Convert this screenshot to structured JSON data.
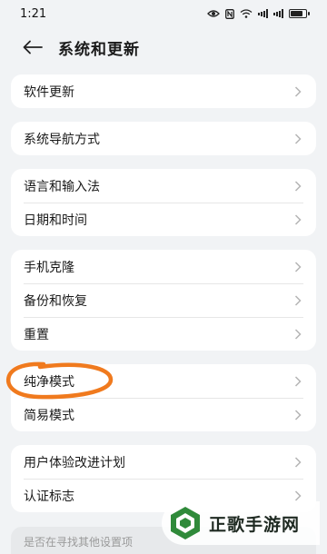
{
  "status": {
    "time": "1:21",
    "battery_level": 0.85
  },
  "header": {
    "title": "系统和更新",
    "back_icon": "arrow-left-icon"
  },
  "groups": [
    {
      "items": [
        {
          "label": "软件更新"
        }
      ]
    },
    {
      "items": [
        {
          "label": "系统导航方式"
        }
      ]
    },
    {
      "items": [
        {
          "label": "语言和输入法"
        },
        {
          "label": "日期和时间"
        }
      ]
    },
    {
      "items": [
        {
          "label": "手机克隆"
        },
        {
          "label": "备份和恢复"
        },
        {
          "label": "重置"
        }
      ]
    },
    {
      "items": [
        {
          "label": "纯净模式"
        },
        {
          "label": "简易模式"
        }
      ]
    },
    {
      "items": [
        {
          "label": "用户体验改进计划"
        },
        {
          "label": "认证标志"
        }
      ]
    }
  ],
  "bottom_hint": {
    "text": "是否在寻找其他设置项"
  },
  "watermark": {
    "text": "正歌手游网"
  },
  "colors": {
    "annotation": "#f07a1e",
    "logo_green": "#2f8a3a",
    "background": "#f1f3f5"
  }
}
